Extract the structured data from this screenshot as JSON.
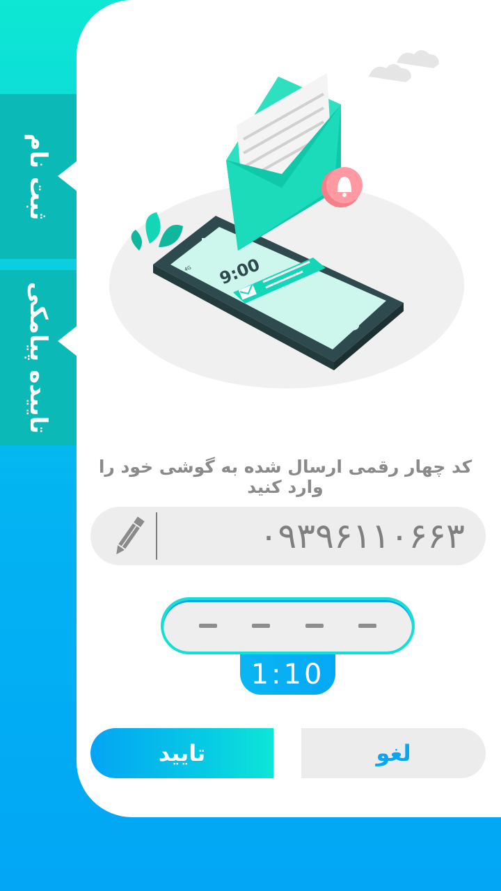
{
  "tabs": {
    "register": "ثبت نام",
    "sms_verify": "تاییده پیامکی"
  },
  "illustration": {
    "clock_time": "9:00",
    "status_bar": "4G",
    "icon": "envelope-phone-illustration"
  },
  "instruction": "کد چهار رقمی ارسال شده به گوشی خود را وارد کنید",
  "phone": {
    "number": "۰۹۳۹۶۱۱۰۶۶۳",
    "edit_icon": "pencil-icon"
  },
  "code": {
    "digits": [
      "–",
      "–",
      "–",
      "–"
    ],
    "timer": "1:10"
  },
  "buttons": {
    "confirm": "تایید",
    "cancel": "لغو"
  },
  "colors": {
    "accent_teal": "#0ee6d6",
    "accent_blue": "#03a4f4",
    "tab_bg": "#0bb9b7"
  }
}
